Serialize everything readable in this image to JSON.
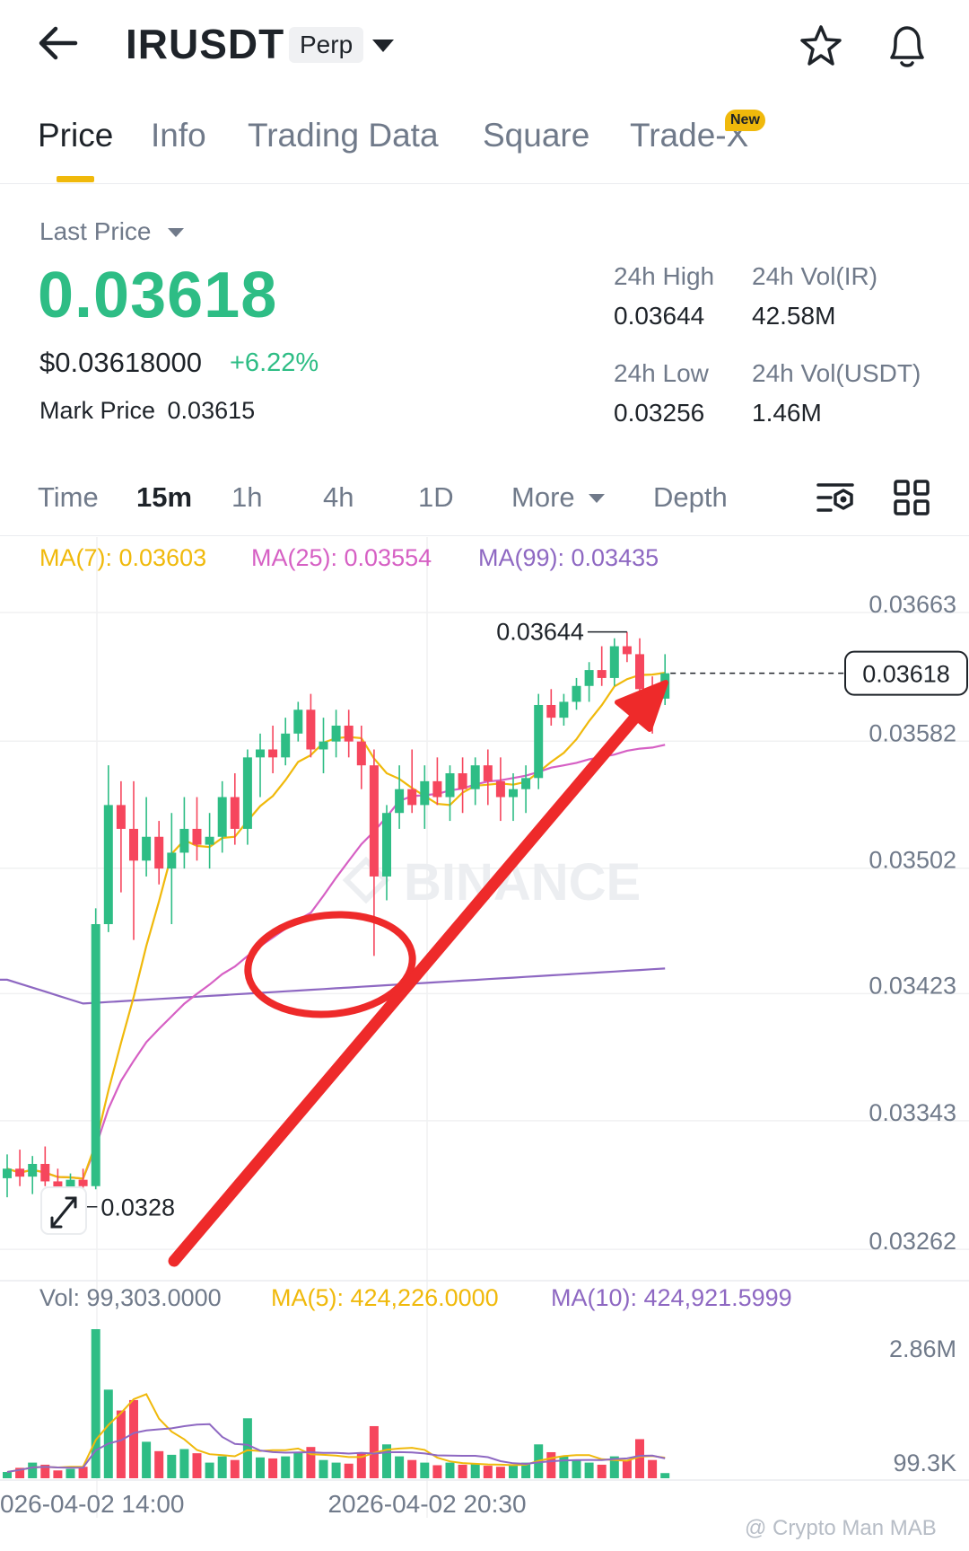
{
  "header": {
    "symbol": "IRUSDT",
    "contract_badge": "Perp"
  },
  "tabs": [
    {
      "label": "Price",
      "active": true
    },
    {
      "label": "Info",
      "active": false
    },
    {
      "label": "Trading Data",
      "active": false
    },
    {
      "label": "Square",
      "active": false
    },
    {
      "label": "Trade-X",
      "active": false
    }
  ],
  "new_badge": "New",
  "ticker": {
    "last_price_label": "Last Price",
    "last_price": "0.03618",
    "usd_price": "$0.03618000",
    "change_pct": "+6.22%",
    "mark_price_label": "Mark Price",
    "mark_price": "0.03615",
    "high_label": "24h High",
    "high": "0.03644",
    "low_label": "24h Low",
    "low": "0.03256",
    "vol_base_label": "24h Vol(IR)",
    "vol_base": "42.58M",
    "vol_quote_label": "24h Vol(USDT)",
    "vol_quote": "1.46M"
  },
  "intervals": {
    "time": "Time",
    "m15": "15m",
    "h1": "1h",
    "h4": "4h",
    "d1": "1D",
    "more": "More",
    "depth": "Depth"
  },
  "legend": {
    "ma7": "MA(7): 0.03603",
    "ma25": "MA(25): 0.03554",
    "ma99": "MA(99): 0.03435",
    "vol": "Vol: 99,303.0000",
    "vol_ma5": "MA(5): 424,226.0000",
    "vol_ma10": "MA(10): 424,921.5999"
  },
  "colors": {
    "up": "#2ebd85",
    "down": "#f6465d",
    "ma7": "#f0b90b",
    "ma25": "#d660c4",
    "ma99": "#8e68c2",
    "annotation": "#ee2a2a",
    "accent": "#f0b90b"
  },
  "credit": "@ Crypto Man MAB",
  "chart_data": {
    "type": "candlestick",
    "watermark": "BINANCE",
    "price_axis_ticks": [
      "0.03663",
      "0.03582",
      "0.03502",
      "0.03423",
      "0.03343",
      "0.03262"
    ],
    "price_ylim": [
      0.0324,
      0.0368
    ],
    "current_price_tag": "0.03618",
    "high_marker": "0.03644",
    "low_marker": "0.0328",
    "volume_axis_ticks": [
      "2.86M",
      "99.3K"
    ],
    "x_tick_labels": [
      "026-04-02 14:00",
      "2026-04-02 20:30"
    ],
    "candles": [
      {
        "o": 0.033,
        "h": 0.03315,
        "l": 0.03288,
        "c": 0.03306,
        "v": 120000
      },
      {
        "o": 0.03306,
        "h": 0.03318,
        "l": 0.03295,
        "c": 0.03301,
        "v": 200000
      },
      {
        "o": 0.03301,
        "h": 0.03314,
        "l": 0.0329,
        "c": 0.03309,
        "v": 300000
      },
      {
        "o": 0.03309,
        "h": 0.0332,
        "l": 0.03295,
        "c": 0.03298,
        "v": 260000
      },
      {
        "o": 0.03298,
        "h": 0.03306,
        "l": 0.03282,
        "c": 0.0329,
        "v": 150000
      },
      {
        "o": 0.0329,
        "h": 0.03303,
        "l": 0.03283,
        "c": 0.03299,
        "v": 180000
      },
      {
        "o": 0.03299,
        "h": 0.03306,
        "l": 0.03288,
        "c": 0.03295,
        "v": 220000
      },
      {
        "o": 0.03295,
        "h": 0.0347,
        "l": 0.03293,
        "c": 0.0346,
        "v": 2860000
      },
      {
        "o": 0.0346,
        "h": 0.0356,
        "l": 0.03455,
        "c": 0.03535,
        "v": 1700000
      },
      {
        "o": 0.03535,
        "h": 0.0355,
        "l": 0.0348,
        "c": 0.0352,
        "v": 1300000
      },
      {
        "o": 0.0352,
        "h": 0.0355,
        "l": 0.0345,
        "c": 0.035,
        "v": 1500000
      },
      {
        "o": 0.035,
        "h": 0.0354,
        "l": 0.0349,
        "c": 0.03515,
        "v": 700000
      },
      {
        "o": 0.03515,
        "h": 0.03525,
        "l": 0.03485,
        "c": 0.03495,
        "v": 520000
      },
      {
        "o": 0.03495,
        "h": 0.0353,
        "l": 0.0346,
        "c": 0.03505,
        "v": 450000
      },
      {
        "o": 0.03505,
        "h": 0.0354,
        "l": 0.03495,
        "c": 0.0352,
        "v": 560000
      },
      {
        "o": 0.0352,
        "h": 0.0354,
        "l": 0.035,
        "c": 0.0351,
        "v": 480000
      },
      {
        "o": 0.0351,
        "h": 0.0353,
        "l": 0.03495,
        "c": 0.03515,
        "v": 300000
      },
      {
        "o": 0.03515,
        "h": 0.0355,
        "l": 0.03505,
        "c": 0.0354,
        "v": 420000
      },
      {
        "o": 0.0354,
        "h": 0.03555,
        "l": 0.0351,
        "c": 0.0352,
        "v": 350000
      },
      {
        "o": 0.0352,
        "h": 0.0357,
        "l": 0.0351,
        "c": 0.03565,
        "v": 1150000
      },
      {
        "o": 0.03565,
        "h": 0.0358,
        "l": 0.0354,
        "c": 0.0357,
        "v": 400000
      },
      {
        "o": 0.0357,
        "h": 0.03585,
        "l": 0.03555,
        "c": 0.03565,
        "v": 380000
      },
      {
        "o": 0.03565,
        "h": 0.0359,
        "l": 0.0356,
        "c": 0.0358,
        "v": 420000
      },
      {
        "o": 0.0358,
        "h": 0.036,
        "l": 0.03575,
        "c": 0.03595,
        "v": 500000
      },
      {
        "o": 0.03595,
        "h": 0.03605,
        "l": 0.03565,
        "c": 0.0357,
        "v": 600000
      },
      {
        "o": 0.0357,
        "h": 0.0359,
        "l": 0.03555,
        "c": 0.03575,
        "v": 350000
      },
      {
        "o": 0.03575,
        "h": 0.03595,
        "l": 0.03565,
        "c": 0.03585,
        "v": 300000
      },
      {
        "o": 0.03585,
        "h": 0.03595,
        "l": 0.03565,
        "c": 0.03575,
        "v": 280000
      },
      {
        "o": 0.03575,
        "h": 0.03585,
        "l": 0.03545,
        "c": 0.0356,
        "v": 500000
      },
      {
        "o": 0.0356,
        "h": 0.0357,
        "l": 0.0344,
        "c": 0.0349,
        "v": 1000000
      },
      {
        "o": 0.0349,
        "h": 0.03535,
        "l": 0.03475,
        "c": 0.0353,
        "v": 650000
      },
      {
        "o": 0.0353,
        "h": 0.0356,
        "l": 0.0352,
        "c": 0.03545,
        "v": 420000
      },
      {
        "o": 0.03545,
        "h": 0.0357,
        "l": 0.0353,
        "c": 0.03535,
        "v": 350000
      },
      {
        "o": 0.03535,
        "h": 0.0356,
        "l": 0.0352,
        "c": 0.0355,
        "v": 300000
      },
      {
        "o": 0.0355,
        "h": 0.03565,
        "l": 0.03535,
        "c": 0.0354,
        "v": 250000
      },
      {
        "o": 0.0354,
        "h": 0.0356,
        "l": 0.03525,
        "c": 0.03555,
        "v": 300000
      },
      {
        "o": 0.03555,
        "h": 0.03565,
        "l": 0.0353,
        "c": 0.03545,
        "v": 260000
      },
      {
        "o": 0.03545,
        "h": 0.03565,
        "l": 0.03535,
        "c": 0.0356,
        "v": 280000
      },
      {
        "o": 0.0356,
        "h": 0.0357,
        "l": 0.03535,
        "c": 0.0355,
        "v": 240000
      },
      {
        "o": 0.0355,
        "h": 0.03565,
        "l": 0.03525,
        "c": 0.0354,
        "v": 220000
      },
      {
        "o": 0.0354,
        "h": 0.03555,
        "l": 0.03525,
        "c": 0.03545,
        "v": 260000
      },
      {
        "o": 0.03545,
        "h": 0.0356,
        "l": 0.0353,
        "c": 0.03552,
        "v": 300000
      },
      {
        "o": 0.03552,
        "h": 0.03605,
        "l": 0.03545,
        "c": 0.03598,
        "v": 650000
      },
      {
        "o": 0.03598,
        "h": 0.03608,
        "l": 0.03585,
        "c": 0.0359,
        "v": 500000
      },
      {
        "o": 0.0359,
        "h": 0.03605,
        "l": 0.03585,
        "c": 0.036,
        "v": 420000
      },
      {
        "o": 0.036,
        "h": 0.03615,
        "l": 0.03595,
        "c": 0.0361,
        "v": 350000
      },
      {
        "o": 0.0361,
        "h": 0.03625,
        "l": 0.036,
        "c": 0.0362,
        "v": 300000
      },
      {
        "o": 0.0362,
        "h": 0.03635,
        "l": 0.0361,
        "c": 0.03615,
        "v": 260000
      },
      {
        "o": 0.03615,
        "h": 0.0364,
        "l": 0.0361,
        "c": 0.03635,
        "v": 420000
      },
      {
        "o": 0.03635,
        "h": 0.03644,
        "l": 0.03625,
        "c": 0.0363,
        "v": 350000
      },
      {
        "o": 0.0363,
        "h": 0.0364,
        "l": 0.036,
        "c": 0.03608,
        "v": 750000
      },
      {
        "o": 0.03608,
        "h": 0.03616,
        "l": 0.0358,
        "c": 0.03602,
        "v": 350000
      },
      {
        "o": 0.03602,
        "h": 0.0363,
        "l": 0.03598,
        "c": 0.03618,
        "v": 99303
      }
    ]
  }
}
